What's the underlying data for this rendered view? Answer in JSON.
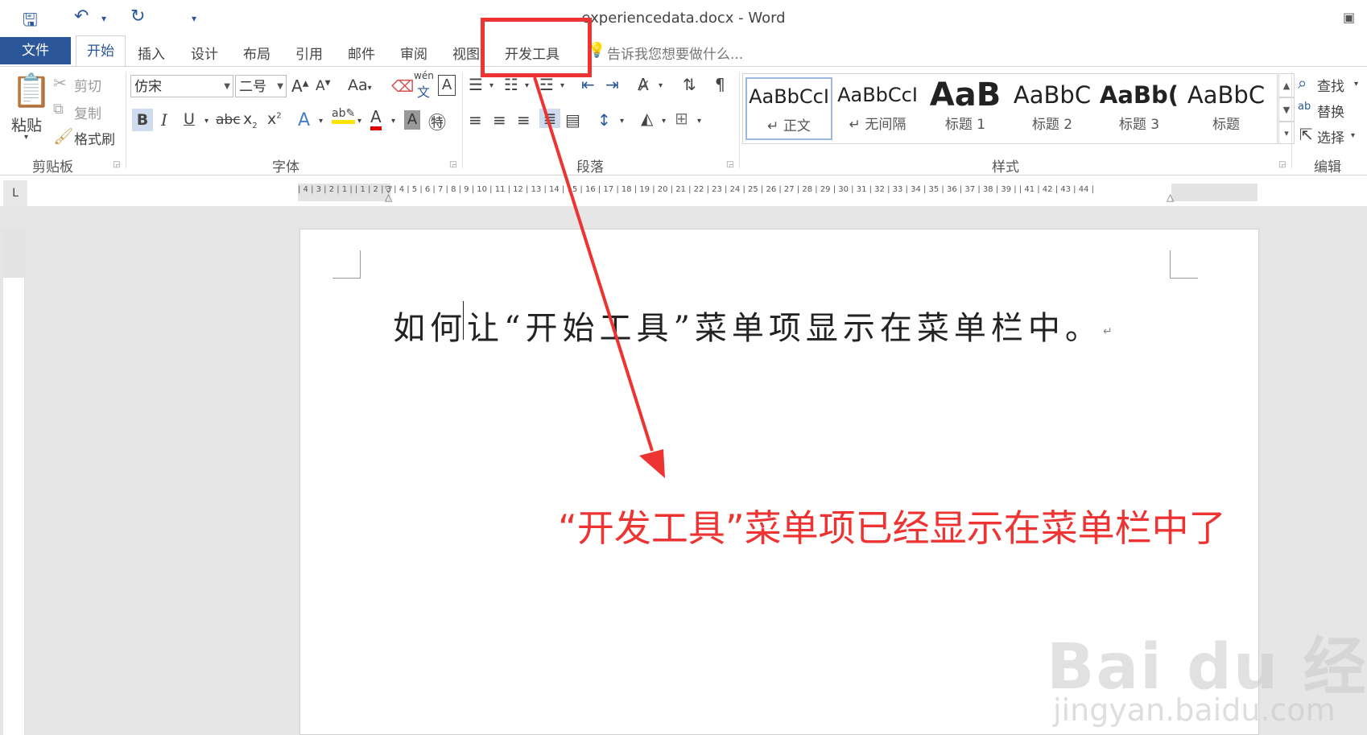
{
  "title_bar": {
    "document_title": "experiencedata.docx - Word",
    "qat_icons": [
      "save-icon",
      "undo-icon",
      "redo-icon",
      "customize-qat-icon"
    ]
  },
  "tabs": {
    "file": "文件",
    "home": "开始",
    "insert": "插入",
    "design": "设计",
    "layout": "布局",
    "references": "引用",
    "mailings": "邮件",
    "review": "审阅",
    "view": "视图",
    "developer": "开发工具",
    "tell_me": "告诉我您想要做什么..."
  },
  "clipboard": {
    "paste": "粘贴",
    "cut": "剪切",
    "copy": "复制",
    "format_painter": "格式刷",
    "group_label": "剪贴板"
  },
  "font": {
    "font_name": "仿宋",
    "font_size": "二号",
    "change_case": "Aa",
    "phonetic_top": "wén",
    "phonetic_bottom": "文",
    "bold": "B",
    "italic": "I",
    "underline": "U",
    "strikethrough": "abc",
    "subscript": "x",
    "superscript": "x",
    "group_label": "字体"
  },
  "paragraph": {
    "group_label": "段落"
  },
  "styles": {
    "items": [
      {
        "sample": "AaBbCcI",
        "name": "正文"
      },
      {
        "sample": "AaBbCcI",
        "name": "无间隔"
      },
      {
        "sample": "AaB",
        "name": "标题 1"
      },
      {
        "sample": "AaBbC",
        "name": "标题 2"
      },
      {
        "sample": "AaBb(",
        "name": "标题 3"
      },
      {
        "sample": "AaBbC",
        "name": "标题"
      }
    ],
    "group_label": "样式"
  },
  "editing": {
    "find": "查找",
    "replace": "替换",
    "select": "选择",
    "group_label": "编辑"
  },
  "ruler": {
    "numbers": "| 4 | 3 | 2 | 1 |   | 1 | 2 | 3 | 4 | 5 | 6 | 7 | 8 | 9 | 10 | 11 | 12 | 13 | 14 | 15 | 16 | 17 | 18 | 19 | 20 | 21 | 22 | 23 | 24 | 25 | 26 | 27 | 28 | 29 | 30 | 31 | 32 | 33 | 34 | 35 | 36 | 37 | 38 | 39 |   | 41 | 42 | 43 | 44 |",
    "corner": "L"
  },
  "document": {
    "text": "如何让“开始工具”菜单项显示在菜单栏中。",
    "pilcrow": "↵"
  },
  "annotation": {
    "text": "“开发工具”菜单项已经显示在菜单栏中了",
    "color": "#ee3333"
  },
  "watermark": {
    "title": "Bai du 经验",
    "url": "jingyan.baidu.com"
  }
}
